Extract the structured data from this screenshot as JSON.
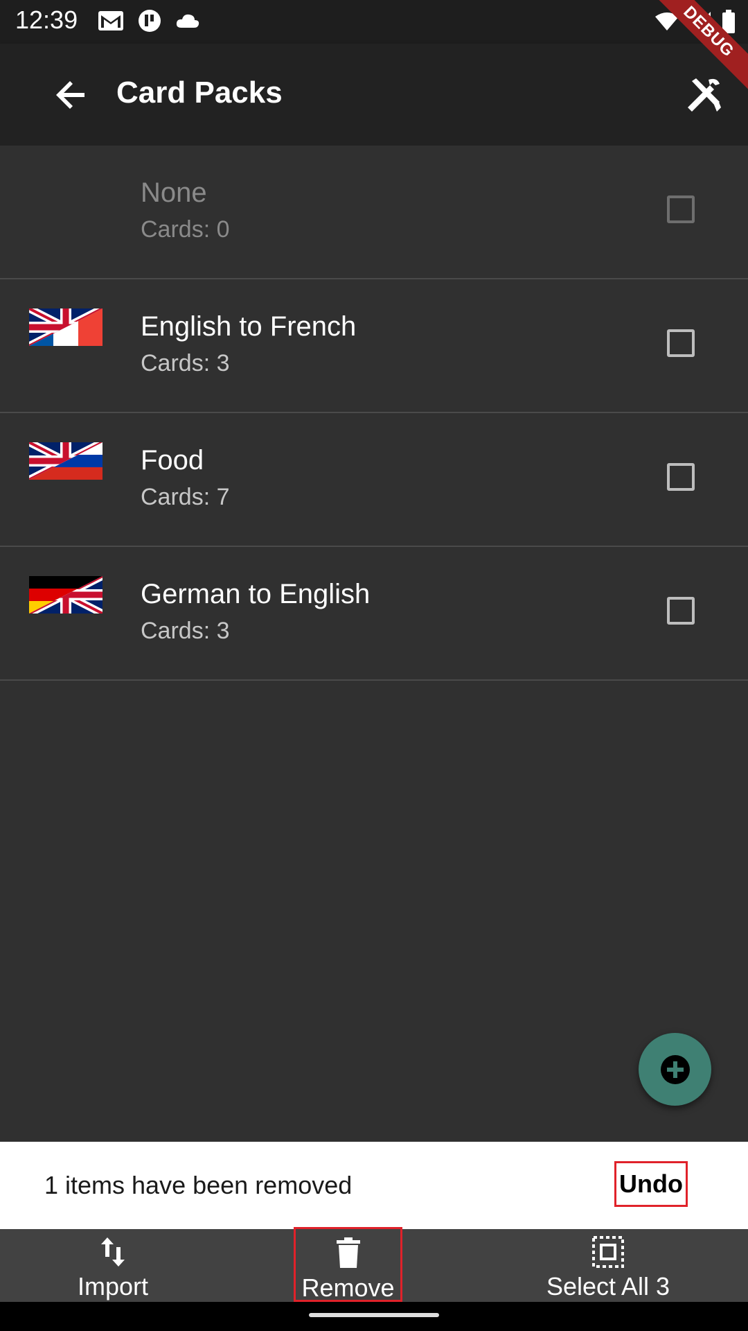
{
  "status_bar": {
    "time": "12:39"
  },
  "app_bar": {
    "title": "Card Packs",
    "debug_label": "DEBUG"
  },
  "packs": [
    {
      "name": "None",
      "cards": "Cards: 0",
      "flag": "none",
      "enabled": false
    },
    {
      "name": "English to French",
      "cards": "Cards: 3",
      "flag": "uk-france"
    },
    {
      "name": "Food",
      "cards": "Cards: 7",
      "flag": "uk-russia"
    },
    {
      "name": "German to English",
      "cards": "Cards: 3",
      "flag": "germany-uk"
    }
  ],
  "snackbar": {
    "message": "1 items have been removed",
    "action": "Undo"
  },
  "bottom_bar": {
    "import_label": "Import",
    "remove_label": "Remove",
    "select_all_label": "Select All 3"
  },
  "colors": {
    "accent": "#3f8073",
    "highlight": "#e0222a",
    "background": "#303030"
  }
}
